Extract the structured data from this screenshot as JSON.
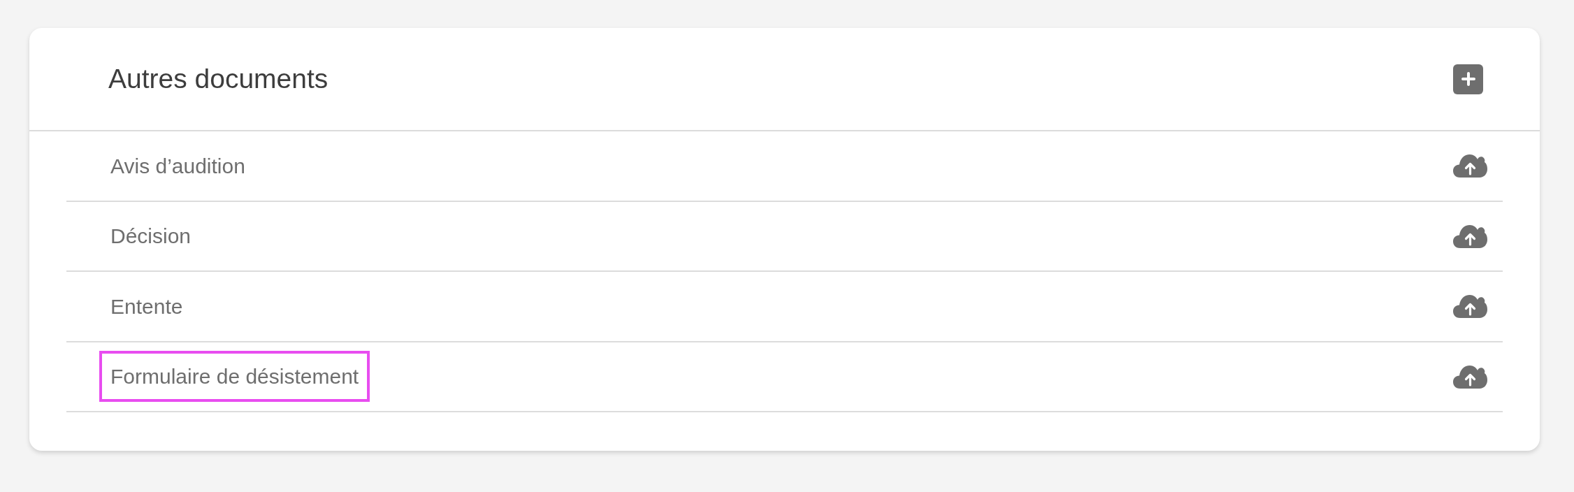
{
  "panel": {
    "title": "Autres documents"
  },
  "documents": [
    {
      "label": "Avis d’audition",
      "highlighted": false
    },
    {
      "label": "Décision",
      "highlighted": false
    },
    {
      "label": "Entente",
      "highlighted": false
    },
    {
      "label": "Formulaire de désistement",
      "highlighted": true
    }
  ]
}
